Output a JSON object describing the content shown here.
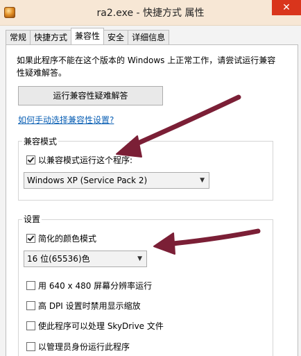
{
  "window": {
    "title": "ra2.exe - 快捷方式 属性",
    "close_label": "✕",
    "app_icon": "red-alert-app-icon"
  },
  "tabs": [
    {
      "label": "常规",
      "active": false
    },
    {
      "label": "快捷方式",
      "active": false
    },
    {
      "label": "兼容性",
      "active": true
    },
    {
      "label": "安全",
      "active": false
    },
    {
      "label": "详细信息",
      "active": false
    }
  ],
  "compat_page": {
    "intro_text": "如果此程序不能在这个版本的 Windows 上正常工作，请尝试运行兼容性疑难解答。",
    "run_troubleshooter_label": "运行兼容性疑难解答",
    "manual_link": "如何手动选择兼容性设置?",
    "compat_mode": {
      "group_label": "兼容模式",
      "checkbox_label": "以兼容模式运行这个程序:",
      "checked": true,
      "selected_os": "Windows XP (Service Pack 2)"
    },
    "settings": {
      "group_label": "设置",
      "reduced_color": {
        "label": "简化的颜色模式",
        "checked": true
      },
      "color_depth": "16 位(65536)色",
      "options": [
        {
          "label": "用 640 x 480 屏幕分辨率运行",
          "checked": false
        },
        {
          "label": "高 DPI 设置时禁用显示缩放",
          "checked": false
        },
        {
          "label": "使此程序可以处理 SkyDrive 文件",
          "checked": false
        },
        {
          "label": "以管理员身份运行此程序",
          "checked": false
        }
      ]
    }
  },
  "annotations": {
    "arrow_color": "#7b1f36"
  },
  "colors": {
    "titlebar": "#f7e7d5",
    "close_button": "#d9351c",
    "link": "#0a5fb4"
  }
}
